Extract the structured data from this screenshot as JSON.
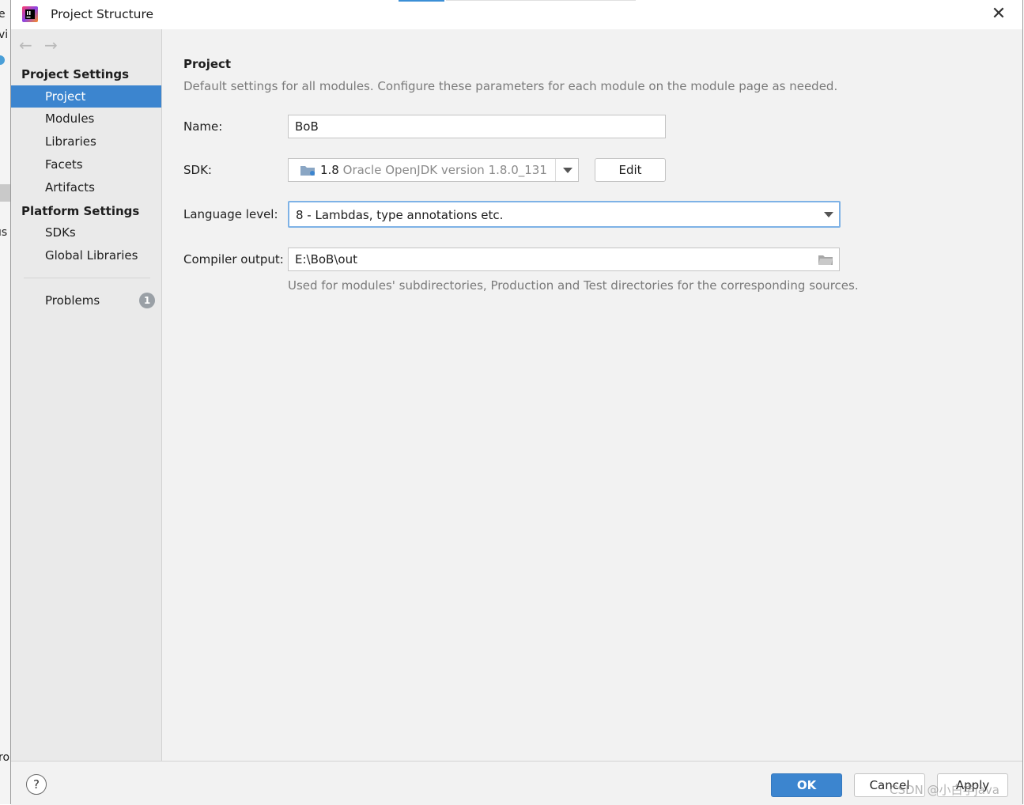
{
  "window": {
    "title": "Project Structure"
  },
  "sidebar": {
    "nav": {
      "back": "←",
      "forward": "→"
    },
    "project_settings_title": "Project Settings",
    "project_settings_items": [
      {
        "label": "Project",
        "selected": true
      },
      {
        "label": "Modules"
      },
      {
        "label": "Libraries"
      },
      {
        "label": "Facets"
      },
      {
        "label": "Artifacts"
      }
    ],
    "platform_settings_title": "Platform Settings",
    "platform_settings_items": [
      {
        "label": "SDKs"
      },
      {
        "label": "Global Libraries"
      }
    ],
    "problems": {
      "label": "Problems",
      "count": "1"
    }
  },
  "main": {
    "title": "Project",
    "description": "Default settings for all modules. Configure these parameters for each module on the module page as needed.",
    "name": {
      "label": "Name:",
      "value": "BoB"
    },
    "sdk": {
      "label": "SDK:",
      "version": "1.8",
      "description": "Oracle OpenJDK version 1.8.0_131",
      "edit_label": "Edit"
    },
    "language_level": {
      "label": "Language level:",
      "value": "8 - Lambdas, type annotations etc."
    },
    "compiler_output": {
      "label": "Compiler output:",
      "value": "E:\\BoB\\out",
      "hint": "Used for modules' subdirectories, Production and Test directories for the corresponding sources."
    }
  },
  "footer": {
    "help": "?",
    "ok": "OK",
    "cancel": "Cancel",
    "apply": "Apply"
  },
  "behind_window_fragments": [
    "e",
    "vi",
    "ıs",
    "ro"
  ],
  "watermark": "CSDN @小白学java",
  "colors": {
    "accent": "#3c85cf",
    "selected_text": "#ffffff",
    "focus_border": "#7eb2e6"
  },
  "icons": [
    "intellij-app-icon",
    "close-icon",
    "back-arrow-icon",
    "forward-arrow-icon",
    "folder-icon",
    "dropdown-arrow-icon",
    "help-icon",
    "problems-badge-icon"
  ]
}
